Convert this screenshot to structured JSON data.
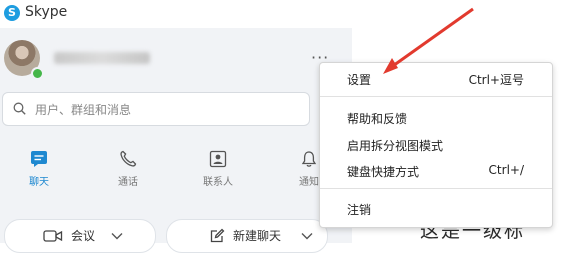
{
  "app": {
    "title": "Skype",
    "logo_letter": "S"
  },
  "search": {
    "placeholder": "用户、群组和消息"
  },
  "nav": [
    {
      "label": "聊天",
      "icon": "chat-icon"
    },
    {
      "label": "通话",
      "icon": "phone-icon"
    },
    {
      "label": "联系人",
      "icon": "contacts-icon"
    },
    {
      "label": "通知",
      "icon": "bell-icon"
    }
  ],
  "bottom_buttons": {
    "meet": {
      "label": "会议",
      "icon": "video-camera-icon"
    },
    "new_chat": {
      "label": "新建聊天",
      "icon": "compose-icon"
    }
  },
  "more_button": {
    "label": "···"
  },
  "menu": {
    "settings": {
      "label": "设置",
      "shortcut": "Ctrl+逗号"
    },
    "help": {
      "label": "帮助和反馈"
    },
    "split_view": {
      "label": "启用拆分视图模式"
    },
    "shortcuts": {
      "label": "键盘快捷方式",
      "shortcut": "Ctrl+/"
    },
    "signout": {
      "label": "注销"
    }
  },
  "backdrop": {
    "text": "这是一级标"
  },
  "colors": {
    "accent": "#1e88d0",
    "annotation_arrow": "#e23a2e",
    "presence_online": "#45b649"
  }
}
